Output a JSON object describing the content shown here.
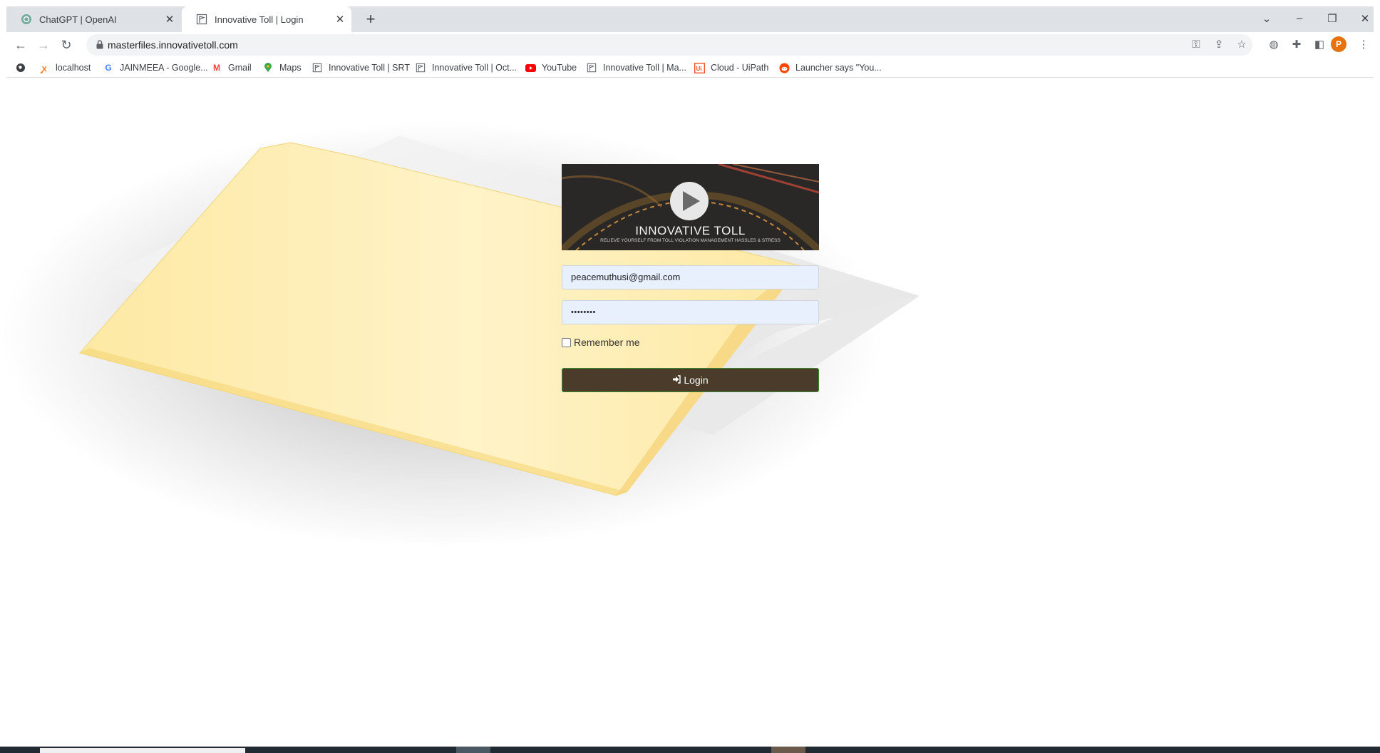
{
  "browser": {
    "tabs": [
      {
        "title": "ChatGPT | OpenAI",
        "active": false
      },
      {
        "title": "Innovative Toll | Login",
        "active": true
      }
    ],
    "url": "masterfiles.innovativetoll.com",
    "profile_initial": "P"
  },
  "bookmarks": [
    {
      "label": "localhost",
      "icon": "xampp-icon"
    },
    {
      "label": "JAINMEEA - Google...",
      "icon": "google-icon"
    },
    {
      "label": "Gmail",
      "icon": "gmail-icon"
    },
    {
      "label": "Maps",
      "icon": "maps-icon"
    },
    {
      "label": "Innovative Toll | SRT",
      "icon": "flag-icon"
    },
    {
      "label": "Innovative Toll | Oct...",
      "icon": "flag-icon"
    },
    {
      "label": "YouTube",
      "icon": "youtube-icon"
    },
    {
      "label": "Innovative Toll | Ma...",
      "icon": "flag-icon"
    },
    {
      "label": "Cloud - UiPath",
      "icon": "uipath-icon"
    },
    {
      "label": "Launcher says \"You...",
      "icon": "reddit-icon"
    }
  ],
  "login": {
    "logo_title": "INNOVATIVE TOLL",
    "logo_tagline": "RELIEVE YOURSELF FROM TOLL VIOLATION MANAGEMENT HASSLES & STRESS",
    "email_value": "peacemuthusi@gmail.com",
    "password_value": "••••••••",
    "remember_label": "Remember me",
    "remember_checked": false,
    "button_label": "Login"
  },
  "colors": {
    "button_bg": "#4a3b2a",
    "field_bg": "#e8f0fe",
    "folder_yellow": "#fde9a3"
  }
}
